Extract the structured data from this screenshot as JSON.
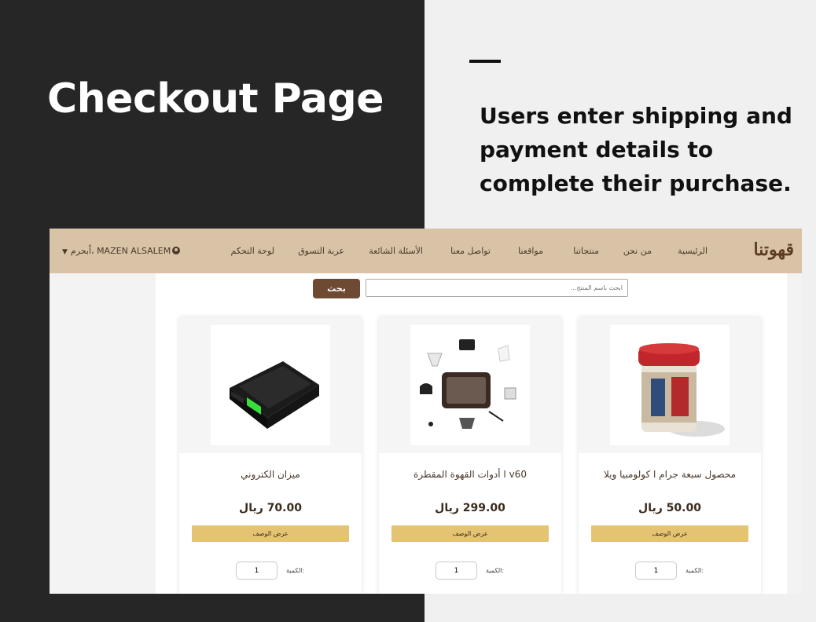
{
  "slide": {
    "title": "Checkout Page",
    "description": "Users enter shipping and payment details to complete their purchase."
  },
  "navbar": {
    "brand": "قهوتنا",
    "items": [
      {
        "label": "الرئيسية"
      },
      {
        "label": "من نحن"
      },
      {
        "label": "منتجاتنا"
      },
      {
        "label": "مواقعنا"
      },
      {
        "label": "تواصل معنا"
      },
      {
        "label": "الأسئلة الشائعة"
      },
      {
        "label": "عربة التسوق"
      },
      {
        "label": "لوحة التحكم"
      }
    ],
    "user": {
      "label": "مرحباً، MAZEN ALSALEM",
      "icon": "user-circle-icon",
      "caret_icon": "caret-down-icon"
    }
  },
  "search": {
    "placeholder": "ابحث باسم المنتج...",
    "button_label": "بحث"
  },
  "products": [
    {
      "title": "محصول سبعة جرام ا كولومبيا ويلا",
      "price": "50.00 ريال",
      "desc_button": "عرض الوصف",
      "qty_label": "الكمية:",
      "qty_value": "1",
      "image": "coffee-tin-image"
    },
    {
      "title": "v60 ا أدوات القهوة المقطرة",
      "price": "299.00 ريال",
      "desc_button": "عرض الوصف",
      "qty_label": "الكمية:",
      "qty_value": "1",
      "image": "v60-kit-image"
    },
    {
      "title": "ميزان الكتروني",
      "price": "70.00 ريال",
      "desc_button": "عرض الوصف",
      "qty_label": "الكمية:",
      "qty_value": "1",
      "image": "digital-scale-image"
    }
  ],
  "colors": {
    "navbar": "#d9c3a7",
    "search_button": "#6e4a33",
    "desc_button": "#e4c373",
    "dark_panel": "#262626"
  }
}
